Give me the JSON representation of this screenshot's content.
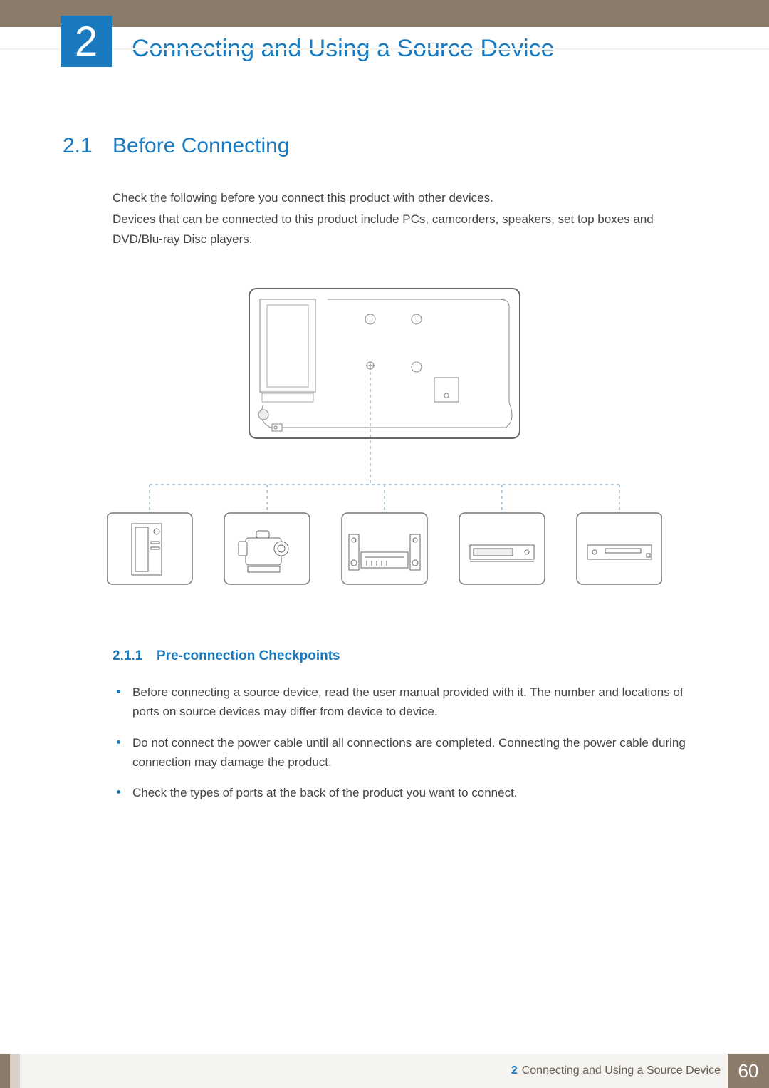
{
  "chapter": {
    "number": "2",
    "title": "Connecting and Using a Source Device"
  },
  "section": {
    "number": "2.1",
    "title": "Before Connecting",
    "intro_line1": "Check the following before you connect this product with other devices.",
    "intro_line2": "Devices that can be connected to this product include PCs, camcorders, speakers, set top boxes and DVD/Blu-ray Disc players."
  },
  "subsection": {
    "number": "2.1.1",
    "title": "Pre-connection Checkpoints",
    "bullets": [
      "Before connecting a source device, read the user manual provided with it. The number and locations of ports on source devices may differ from device to device.",
      "Do not connect the power cable until all connections are completed. Connecting the power cable during connection may damage the product.",
      "Check the types of ports at the back of the product you want to connect."
    ]
  },
  "footer": {
    "chapter_num": "2",
    "chapter_title": "Connecting and Using a Source Device",
    "page": "60"
  },
  "diagram_devices": [
    "pc-tower",
    "camcorder",
    "speakers-receiver",
    "set-top-box",
    "dvd-player"
  ]
}
